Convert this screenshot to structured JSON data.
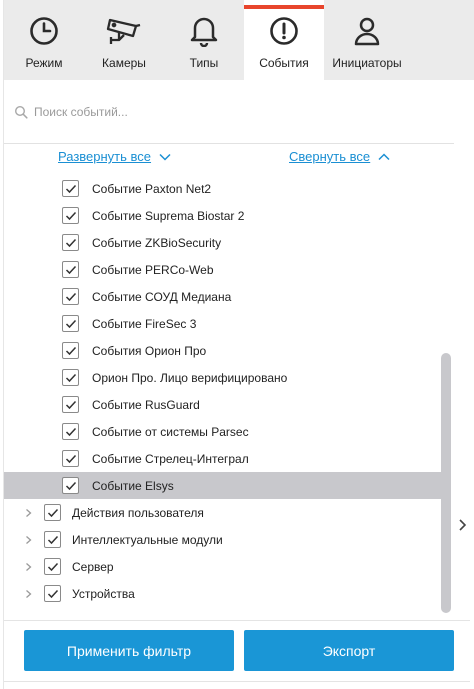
{
  "tabs": [
    {
      "label": "Режим",
      "icon": "clock-icon"
    },
    {
      "label": "Камеры",
      "icon": "camera-icon"
    },
    {
      "label": "Типы",
      "icon": "bell-icon"
    },
    {
      "label": "События",
      "icon": "alert-circle-icon",
      "active": true
    },
    {
      "label": "Инициаторы",
      "icon": "user-icon"
    }
  ],
  "search": {
    "placeholder": "Поиск событий..."
  },
  "links": {
    "expand_all": "Развернуть все",
    "collapse_all": "Свернуть все"
  },
  "events": [
    "Событие Paxton Net2",
    "Событие Suprema Biostar 2",
    "Событие ZKBioSecurity",
    "Событие PERCo-Web",
    "Событие СОУД Медиана",
    "Событие FireSec 3",
    "События Орион Про",
    "Орион Про. Лицо верифицировано",
    "Событие RusGuard",
    "Событие от системы Parsec",
    "Событие Стрелец-Интеграл",
    "Событие Elsys"
  ],
  "groups": [
    "Действия пользователя",
    "Интеллектуальные модули",
    "Сервер",
    "Устройства"
  ],
  "buttons": {
    "apply": "Применить фильтр",
    "export": "Экспорт"
  },
  "colors": {
    "accent": "#1a96d6",
    "active_tab_marker": "#e8452c",
    "selected_row": "#c8c8cc"
  }
}
